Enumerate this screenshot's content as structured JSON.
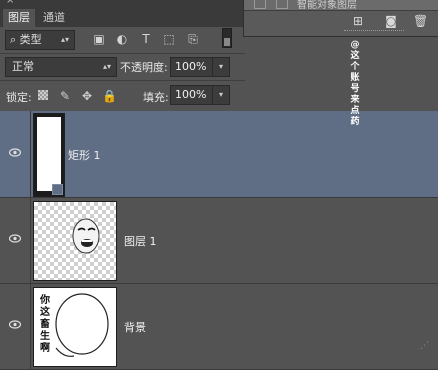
{
  "tabs": [
    {
      "label": "图层",
      "active": true
    },
    {
      "label": "通道",
      "active": false
    }
  ],
  "float_panel": {
    "row_text": "智能对象图层"
  },
  "filter": {
    "kind_label": "类型"
  },
  "blend": {
    "mode": "正常",
    "opacity_label": "不透明度:",
    "opacity_value": "100%"
  },
  "lock": {
    "label": "锁定:",
    "fill_label": "填充:",
    "fill_value": "100%"
  },
  "layers": [
    {
      "name": "矩形 1",
      "selected": true
    },
    {
      "name": "图层 1",
      "selected": false
    },
    {
      "name": "背景",
      "selected": false
    }
  ],
  "thumb_bg_text": [
    "你",
    "这",
    "畜",
    "生",
    "啊"
  ],
  "watermark": {
    "chars": [
      "@",
      "这",
      "个",
      "账",
      "号",
      "来",
      "点",
      "药"
    ]
  },
  "colors": {
    "panel_bg": "#535353",
    "selected_row": "#5f6d85",
    "tab_bar": "#3a3a3a"
  }
}
